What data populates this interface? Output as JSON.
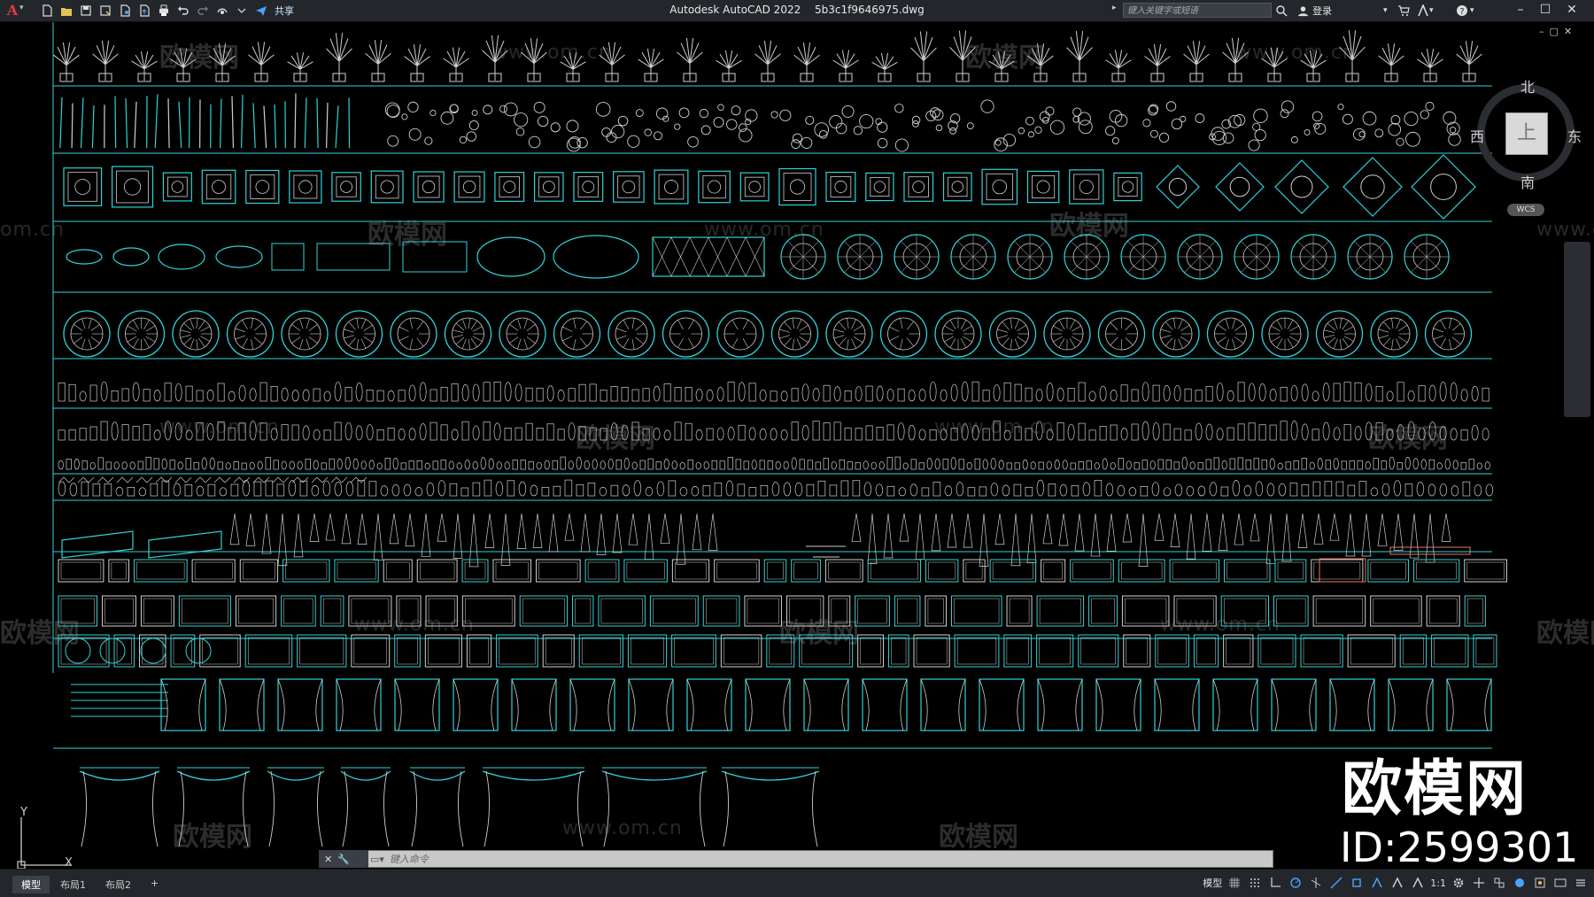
{
  "app": {
    "name": "Autodesk AutoCAD 2022",
    "file": "5b3c1f9646975.dwg",
    "logo_letter": "A"
  },
  "quick_access": {
    "share_label": "共享"
  },
  "search": {
    "placeholder": "键入关键字或短语"
  },
  "user": {
    "login_label": "登录"
  },
  "viewcube": {
    "north": "北",
    "south": "南",
    "west": "西",
    "east": "东",
    "face": "上",
    "wcs": "WCS"
  },
  "ucs": {
    "y_label": "Y",
    "x_label": "X"
  },
  "command": {
    "placeholder": "键入命令"
  },
  "layout_tabs": [
    {
      "label": "模型",
      "active": true
    },
    {
      "label": "布局1",
      "active": false
    },
    {
      "label": "布局2",
      "active": false
    }
  ],
  "status": {
    "model_label": "模型",
    "scale_label": "1:1"
  },
  "watermark": {
    "brand": "欧模网",
    "url": "www.om.cn",
    "id_text": "ID:2599301",
    "left_fragment": "om.cn"
  },
  "colors": {
    "cad_cyan": "#2fd3d8",
    "cad_white": "#cfcfcf",
    "accent_red": "#e23b3b"
  }
}
